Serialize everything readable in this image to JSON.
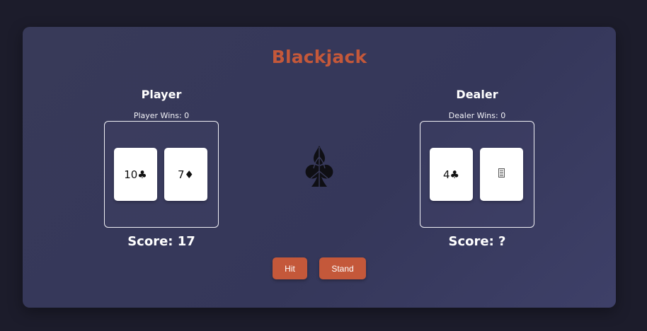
{
  "game": {
    "title": "Blackjack",
    "accent_color": "#c4583a"
  },
  "player": {
    "heading": "Player",
    "wins_label": "Player Wins: 0",
    "cards": [
      {
        "label": "10♣"
      },
      {
        "label": "7♦"
      }
    ],
    "score_label": "Score: 17"
  },
  "dealer": {
    "heading": "Dealer",
    "wins_label": "Dealer Wins: 0",
    "cards": [
      {
        "label": "4♣"
      },
      {
        "label": "",
        "face_down": true,
        "icon": "card-back-icon"
      }
    ],
    "score_label": "Score: ?"
  },
  "center": {
    "icon": "club-suit-icon"
  },
  "actions": {
    "hit_label": "Hit",
    "stand_label": "Stand"
  }
}
